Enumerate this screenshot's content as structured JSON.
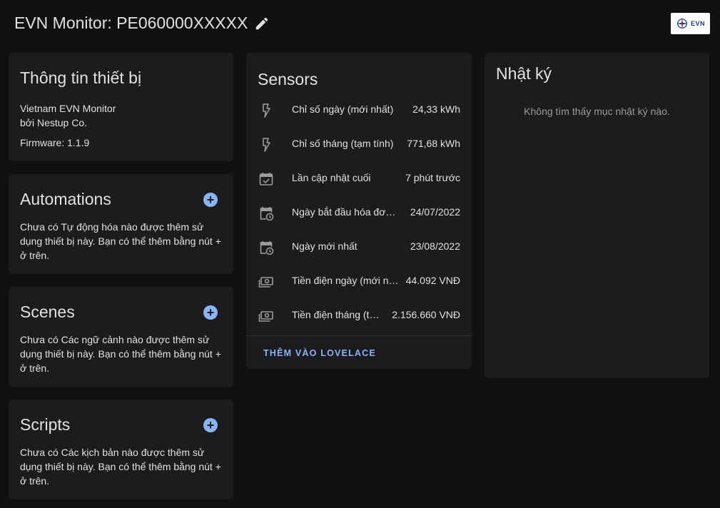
{
  "header": {
    "title": "EVN Monitor: PE060000XXXXX",
    "logo_text": "EVN"
  },
  "device_info": {
    "title": "Thông tin thiết bị",
    "model": "Vietnam EVN Monitor",
    "manufacturer": "bởi Nestup Co.",
    "firmware": "Firmware: 1.1.9"
  },
  "automations": {
    "title": "Automations",
    "text": "Chưa có Tự động hóa nào được thêm sử dụng thiết bị này. Bạn có thể thêm bằng nút + ở trên."
  },
  "scenes": {
    "title": "Scenes",
    "text": "Chưa có Các ngữ cảnh nào được thêm sử dụng thiết bị này. Bạn có thể thêm bằng nút + ở trên."
  },
  "scripts": {
    "title": "Scripts",
    "text": "Chưa có Các kịch bản nào được thêm sử dụng thiết bị này. Bạn có thể thêm bằng nút + ở trên."
  },
  "sensors": {
    "title": "Sensors",
    "items": [
      {
        "icon": "flash-icon",
        "name": "Chỉ số ngày (mới nhất)",
        "value": "24,33 kWh"
      },
      {
        "icon": "flash-icon",
        "name": "Chỉ số tháng (tạm tính)",
        "value": "771,68 kWh"
      },
      {
        "icon": "calendar-check-icon",
        "name": "Lần cập nhật cuối",
        "value": "7 phút trước"
      },
      {
        "icon": "calendar-clock-icon",
        "name": "Ngày bắt đầu hóa đơn …",
        "value": "24/07/2022"
      },
      {
        "icon": "calendar-clock-icon",
        "name": "Ngày mới nhất",
        "value": "23/08/2022"
      },
      {
        "icon": "cash-icon",
        "name": "Tiền điện ngày (mới nh…",
        "value": "44.092 VNĐ"
      },
      {
        "icon": "cash-icon",
        "name": "Tiền điện tháng (tạ…",
        "value": "2.156.660 VNĐ"
      }
    ],
    "add_lovelace": "THÊM VÀO LOVELACE"
  },
  "logbook": {
    "title": "Nhật ký",
    "empty": "Không tìm thấy mục nhật ký nào."
  },
  "colors": {
    "background": "#111111",
    "card": "#1c1c1e",
    "accent": "#8ab4f8",
    "text": "#e1e1e1",
    "muted": "#9b9b9b"
  }
}
